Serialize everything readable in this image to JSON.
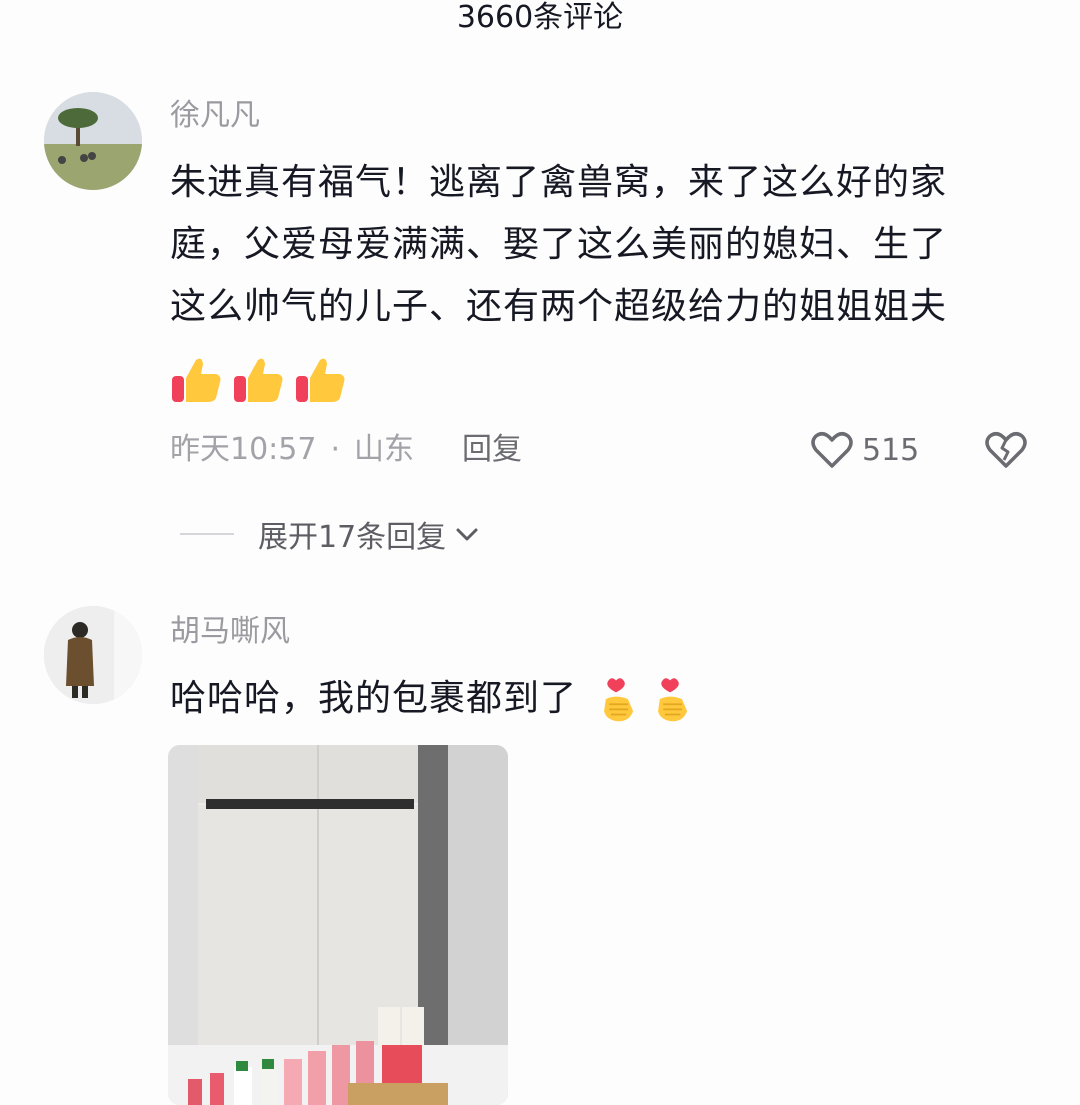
{
  "header": {
    "title": "3660条评论"
  },
  "comments": [
    {
      "username": "徐凡凡",
      "text_lines": [
        "朱进真有福气！逃离了禽兽窝，来了这么好的家",
        "庭，父爱母爱满满、娶了这么美丽的媳妇、生了",
        "这么帅气的儿子、还有两个超级给力的姐姐姐夫"
      ],
      "emojis": [
        "thumbs-up-icon",
        "thumbs-up-icon",
        "thumbs-up-icon"
      ],
      "time": "昨天10:57",
      "dot": "·",
      "location": "山东",
      "reply_label": "回复",
      "like_count": "515",
      "expand_label": "展开17条回复"
    },
    {
      "username": "胡马嘶风",
      "text": "哈哈哈，我的包裹都到了",
      "emojis": [
        "finger-heart-icon",
        "finger-heart-icon"
      ]
    }
  ],
  "colors": {
    "text": "#161823",
    "secondary": "#9a9aa0",
    "emoji_yellow": "#ffc83d",
    "heart_red": "#f0405a"
  }
}
